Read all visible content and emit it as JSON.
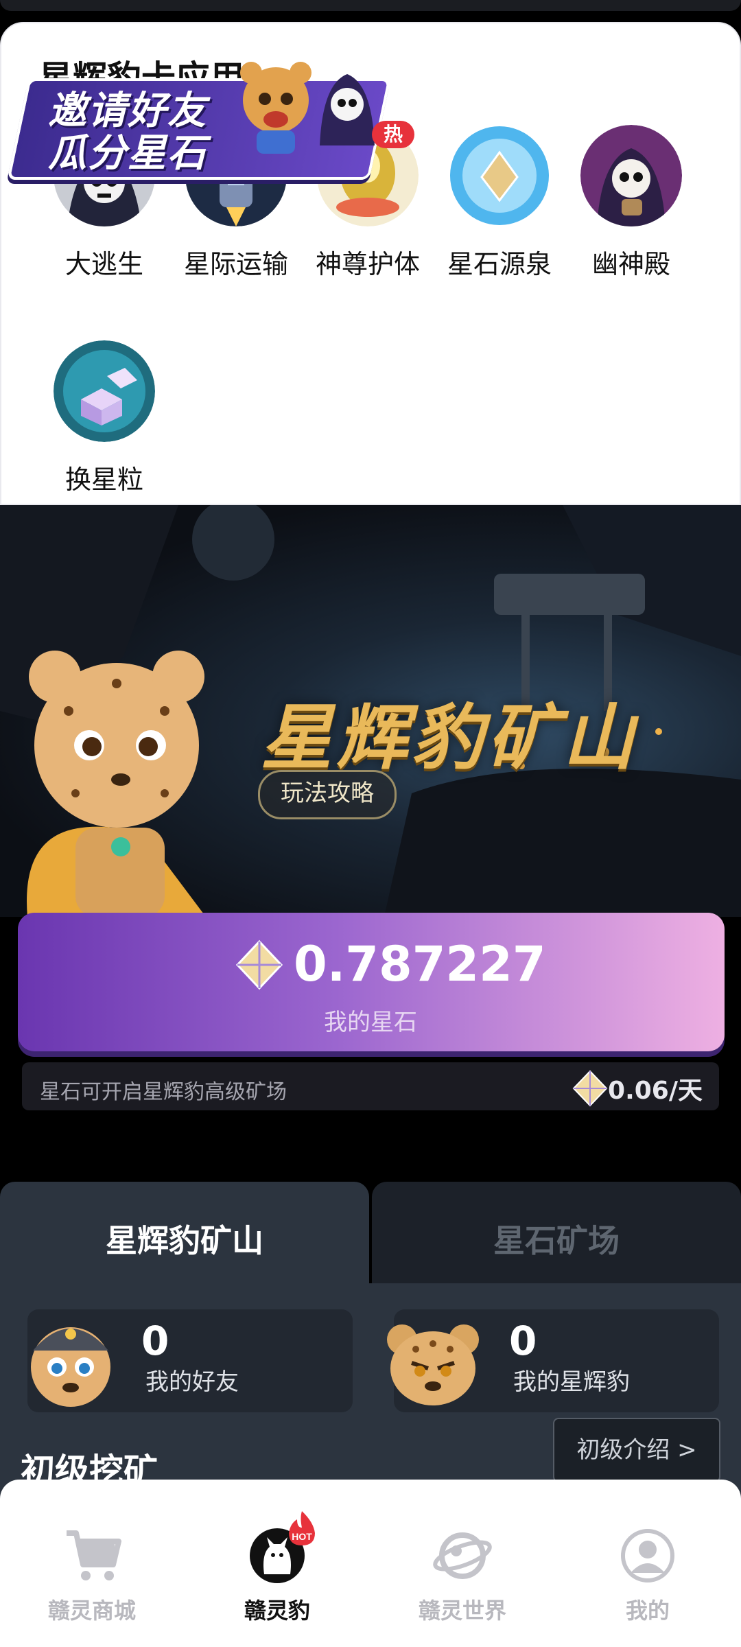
{
  "app_section": {
    "title": "星辉豹卡应用",
    "apps": [
      {
        "label": "大逃生",
        "icon": "reaper-skull-icon"
      },
      {
        "label": "星际运输",
        "icon": "spaceship-icon"
      },
      {
        "label": "神尊护体",
        "icon": "golden-shield-icon"
      },
      {
        "label": "星石源泉",
        "icon": "crystal-orb-icon"
      },
      {
        "label": "幽神殿",
        "icon": "ghost-reaper-icon"
      },
      {
        "label": "换星粒",
        "icon": "crystal-cubes-icon"
      }
    ],
    "hot_badge": "热"
  },
  "invite_banner": {
    "line1": "邀请好友",
    "line2": "瓜分星石"
  },
  "mine": {
    "title": "星辉豹矿山",
    "guide_button": "玩法攻略",
    "stone_value": "0.787227",
    "stone_caption": "我的星石",
    "rate_text": "星石可开启星辉豹高级矿场",
    "rate_value": "0.06/天"
  },
  "tabs": [
    {
      "label": "星辉豹矿山",
      "active": true
    },
    {
      "label": "星石矿场",
      "active": false
    }
  ],
  "stats": [
    {
      "value": "0",
      "label": "我的好友"
    },
    {
      "value": "0",
      "label": "我的星辉豹"
    }
  ],
  "primary_mining": {
    "title": "初级挖矿",
    "intro_button": "初级介绍 >"
  },
  "bottom_nav": [
    {
      "label": "赣灵商城",
      "icon": "cart-icon",
      "active": false
    },
    {
      "label": "赣灵豹",
      "icon": "leopard-icon",
      "active": true,
      "badge": "HOT"
    },
    {
      "label": "赣灵世界",
      "icon": "planet-icon",
      "active": false
    },
    {
      "label": "我的",
      "icon": "profile-icon",
      "active": false
    }
  ],
  "colors": {
    "accent_purple": "#6a36b0",
    "accent_pink": "#eeb0e2",
    "gold": "#e9b95a",
    "hot_red": "#e7323b"
  }
}
